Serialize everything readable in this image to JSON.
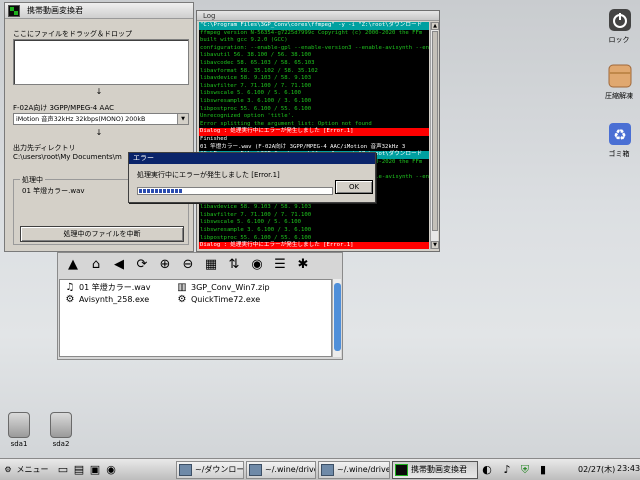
{
  "log_window": {
    "title": "Log",
    "lines": [
      {
        "text": "\"C:\\Program Files\\3GP_Conv\\cores\\ffmpeg\" -y -i \"Z:\\root\\ダウンロード",
        "style": "hl"
      },
      {
        "text": "ffmpeg version N-56354-g7225d7999c Copyright (c) 2000-2020 the FFm",
        "style": ""
      },
      {
        "text": "  built with gcc 9.2.0 (GCC)",
        "style": ""
      },
      {
        "text": "  configuration: --enable-gpl --enable-version3 --enable-avisynth --enabl",
        "style": ""
      },
      {
        "text": "  libavutil      56. 38.100 / 56. 38.100",
        "style": ""
      },
      {
        "text": "  libavcodec     58. 65.103 / 58. 65.103",
        "style": ""
      },
      {
        "text": "  libavformat    58. 35.102 / 58. 35.102",
        "style": ""
      },
      {
        "text": "  libavdevice    58.  9.103 / 58.  9.103",
        "style": ""
      },
      {
        "text": "  libavfilter     7. 71.100 /  7. 71.100",
        "style": ""
      },
      {
        "text": "  libswscale      5.  6.100 /  5.  6.100",
        "style": ""
      },
      {
        "text": "  libswresample   3.  6.100 /  3.  6.100",
        "style": ""
      },
      {
        "text": "  libpostproc    55.  6.100 / 55.  6.100",
        "style": ""
      },
      {
        "text": "Unrecognized option 'title'.",
        "style": ""
      },
      {
        "text": "Error splitting the argument list: Option not found",
        "style": ""
      },
      {
        "text": "Dialog : 処理実行中にエラーが発生しました [Error.1]",
        "style": "err"
      },
      {
        "text": "Finished",
        "style": "white"
      },
      {
        "text": "01 竿燈カラー.wav (F-02A向け 3GPP/MPEG-4 AAC/iMotion 音声32kHz 3",
        "style": "white"
      },
      {
        "text": "\"C:\\Program Files\\3GP_Conv\\cores\\ffmpeg\" -y -i \"Z:\\root\\ダウンロード",
        "style": "hl"
      },
      {
        "text": "ffmpeg version N-56354-g7225d7999c Copyright (c) 2000-2020 the FFm",
        "style": ""
      },
      {
        "text": "  built with gcc 9.2.0 (GCC)",
        "style": ""
      },
      {
        "text": "  configuration: --enable-gpl --enable-version3 --enable-avisynth --enabl",
        "style": ""
      },
      {
        "text": "  libavutil      56. 38.100 / 56. 38.100",
        "style": ""
      },
      {
        "text": "  libavcodec     58. 65.103 / 58. 65.103",
        "style": ""
      },
      {
        "text": "  libavformat    58. 35.102 / 58. 35.102",
        "style": ""
      },
      {
        "text": "  libavdevice    58.  9.103 / 58.  9.103",
        "style": ""
      },
      {
        "text": "  libavfilter     7. 71.100 /  7. 71.100",
        "style": ""
      },
      {
        "text": "  libswscale      5.  6.100 /  5.  6.100",
        "style": ""
      },
      {
        "text": "  libswresample   3.  6.100 /  3.  6.100",
        "style": ""
      },
      {
        "text": "  libpostproc    55.  6.100 / 55.  6.100",
        "style": ""
      },
      {
        "text": "Dialog : 処理実行中にエラーが発生しました [Error.1]",
        "style": "err"
      }
    ]
  },
  "main_window": {
    "title": "携帯動画変換君",
    "drop_label": "ここにファイルをドラッグ＆ドロップ",
    "arrow": "↓",
    "format_label": "F-02A向け 3GPP/MPEG-4 AAC",
    "format_value": "iMotion 音声32kHz 32kbps(MONO) 200kB",
    "output_label": "出力先ディレクトリ",
    "output_value": "C:\\users\\root\\My Documents\\m",
    "processing_label": "処理中",
    "processing_file": "01 竿燈カラー.wav",
    "cancel_button": "処理中のファイルを中断"
  },
  "error_dialog": {
    "title": "エラー",
    "message": "処理実行中にエラーが発生しました [Error.1]",
    "ok_button": "OK",
    "progress_fraction": 0.22
  },
  "file_manager": {
    "toolbar_icons": [
      "up-arrow-icon",
      "home-icon",
      "back-icon",
      "refresh-icon",
      "zoom-in-icon",
      "zoom-out-icon",
      "view-icon",
      "sort-icon",
      "eye-icon",
      "list-icon",
      "help-icon"
    ],
    "files": [
      {
        "name": "01 竿燈カラー.wav",
        "icon": "music-icon"
      },
      {
        "name": "3GP_Conv_Win7.zip",
        "icon": "archive-icon"
      },
      {
        "name": "Avisynth_258.exe",
        "icon": "gear-icon"
      },
      {
        "name": "QuickTime72.exe",
        "icon": "gear-icon"
      }
    ]
  },
  "desktop": {
    "icons": [
      {
        "label": "ロック",
        "icon": "power-icon"
      },
      {
        "label": "圧縮解凍",
        "icon": "box-icon"
      },
      {
        "label": "ゴミ箱",
        "icon": "recycle-icon"
      }
    ],
    "drives": [
      {
        "label": "sda1"
      },
      {
        "label": "sda2"
      }
    ]
  },
  "taskbar": {
    "menu_label": "メニュー",
    "tasks": [
      {
        "label": "~/ダウンロード",
        "active": false
      },
      {
        "label": "~/.wine/drive",
        "active": false
      },
      {
        "label": "~/.wine/drive",
        "active": false
      },
      {
        "label": "携帯動画変換君",
        "active": true
      }
    ],
    "date": "02/27(木)",
    "time": "23:43"
  },
  "colors": {
    "log_bg": "#000000",
    "log_text": "#1fc41f",
    "log_highlight": "#00a0a0",
    "log_error": "#ff0000",
    "dialog_title": "#0a246a",
    "window_bg": "#d4d0c8"
  }
}
